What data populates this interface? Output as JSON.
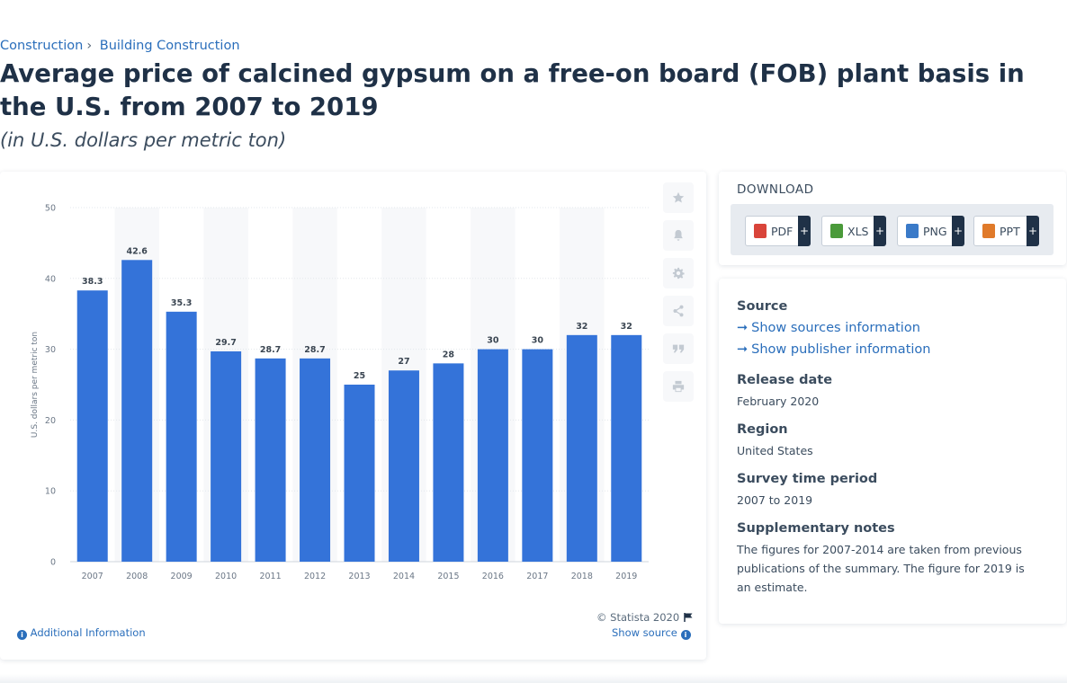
{
  "breadcrumb": {
    "items": [
      "Construction",
      "Building Construction"
    ],
    "separator": "›"
  },
  "title": "Average price of calcined gypsum on a free-on board (FOB) plant basis in the U.S. from 2007 to 2019",
  "subtitle": "(in U.S. dollars per metric ton)",
  "chart_data": {
    "type": "bar",
    "categories": [
      "2007",
      "2008",
      "2009",
      "2010",
      "2011",
      "2012",
      "2013",
      "2014",
      "2015",
      "2016",
      "2017",
      "2018",
      "2019"
    ],
    "values": [
      38.3,
      42.6,
      35.3,
      29.7,
      28.7,
      28.7,
      25,
      27,
      28,
      30,
      30,
      32,
      32
    ],
    "ylabel": "U.S. dollars per metric ton",
    "xlabel": "",
    "ylim": [
      0,
      50
    ],
    "yticks": [
      0,
      10,
      20,
      30,
      40,
      50
    ],
    "bar_color": "#3473d9",
    "grid": true,
    "alternating_column_background": true
  },
  "chart_footer": {
    "copyright": "© Statista 2020",
    "additional_info": "Additional Information",
    "show_source": "Show source"
  },
  "tool_icons": [
    "star-icon",
    "bell-icon",
    "gear-icon",
    "share-icon",
    "quote-icon",
    "print-icon"
  ],
  "download": {
    "title": "DOWNLOAD",
    "buttons": [
      {
        "label": "PDF",
        "plus": "+",
        "icon_color": "#d9443a"
      },
      {
        "label": "XLS",
        "plus": "+",
        "icon_color": "#4a9a3a"
      },
      {
        "label": "PNG",
        "plus": "+",
        "icon_color": "#3a7ac8"
      },
      {
        "label": "PPT",
        "plus": "+",
        "icon_color": "#e07a2a"
      }
    ]
  },
  "source_panel": {
    "source_heading": "Source",
    "show_sources": "Show sources information",
    "show_publisher": "Show publisher information",
    "release_heading": "Release date",
    "release_value": "February 2020",
    "region_heading": "Region",
    "region_value": "United States",
    "period_heading": "Survey time period",
    "period_value": "2007 to 2019",
    "notes_heading": "Supplementary notes",
    "notes_value": "The figures for 2007-2014 are taken from previous publications of the summary. The figure for 2019 is an estimate."
  }
}
